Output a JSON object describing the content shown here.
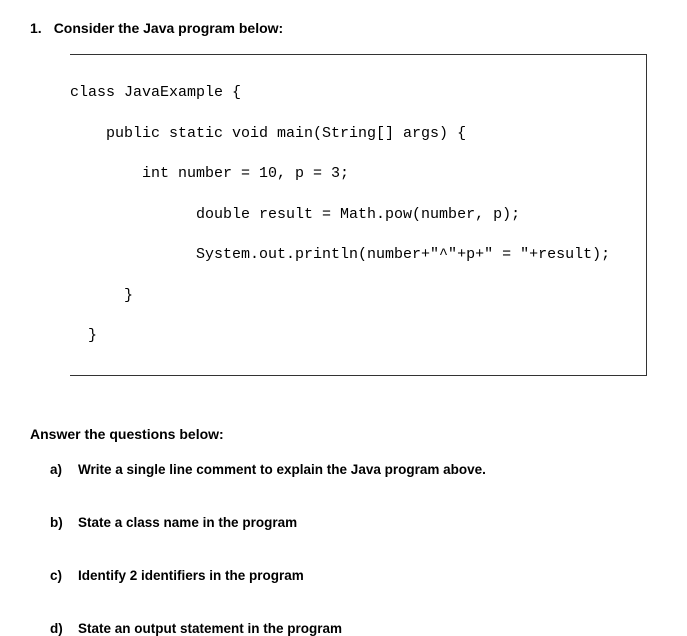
{
  "question": {
    "number": "1.",
    "title": "Consider the Java program below:"
  },
  "code": {
    "line1": "class JavaExample {",
    "line2": "    public static void main(String[] args) {",
    "line3": "        int number = 10, p = 3;",
    "line4": "              double result = Math.pow(number, p);",
    "line5": "              System.out.println(number+\"^\"+p+\" = \"+result);",
    "line6": "      }",
    "line7": "  }"
  },
  "subheading": "Answer the questions below:",
  "subquestions": [
    {
      "letter": "a)",
      "text": "Write a single line comment to explain the Java program above."
    },
    {
      "letter": "b)",
      "text": "State a class name in the program"
    },
    {
      "letter": "c)",
      "text": "Identify 2 identifiers in the program"
    },
    {
      "letter": "d)",
      "text": "State an output statement in the program"
    }
  ]
}
